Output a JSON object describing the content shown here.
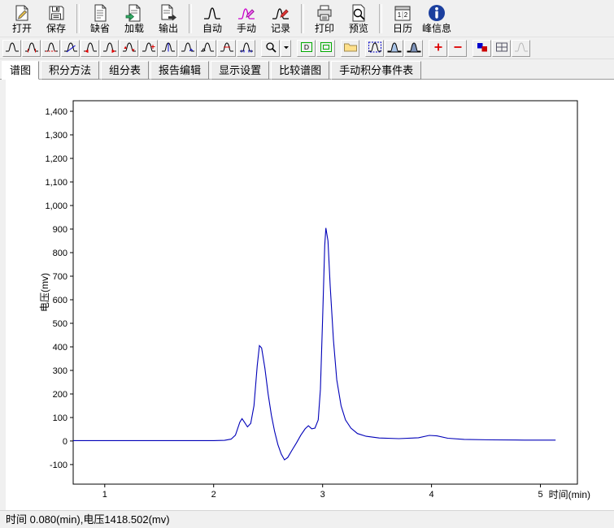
{
  "colors": {
    "line": "#0000b8",
    "toolbar_bg": "#f0f0f0",
    "panel_bg": "#ffffff"
  },
  "main_toolbar": {
    "groups": [
      {
        "items": [
          {
            "name": "open",
            "label": "打开",
            "icon": "open-icon"
          },
          {
            "name": "save",
            "label": "保存",
            "icon": "save-icon"
          }
        ]
      },
      {
        "items": [
          {
            "name": "default",
            "label": "缺省",
            "icon": "doc-default-icon"
          },
          {
            "name": "load",
            "label": "加载",
            "icon": "doc-load-icon"
          },
          {
            "name": "export",
            "label": "输出",
            "icon": "doc-export-icon"
          }
        ]
      },
      {
        "items": [
          {
            "name": "auto-integrate",
            "label": "自动",
            "icon": "auto-peak-icon"
          },
          {
            "name": "manual-integrate",
            "label": "手动",
            "icon": "manual-peak-icon"
          },
          {
            "name": "record",
            "label": "记录",
            "icon": "record-peak-icon"
          }
        ]
      },
      {
        "items": [
          {
            "name": "print",
            "label": "打印",
            "icon": "print-icon"
          },
          {
            "name": "print-preview",
            "label": "预览",
            "icon": "preview-icon"
          }
        ]
      },
      {
        "items": [
          {
            "name": "calendar",
            "label": "日历",
            "icon": "calendar-icon"
          },
          {
            "name": "peak-info",
            "label": "峰信息",
            "icon": "info-icon"
          }
        ]
      }
    ]
  },
  "secondary_toolbar": {
    "groups": [
      {
        "items": [
          {
            "name": "peak-baseline",
            "icon": "peak-plain-icon"
          },
          {
            "name": "peak-start-end",
            "icon": "peak-marks-icon"
          },
          {
            "name": "peak-baseline-dash",
            "icon": "peak-dash-icon"
          },
          {
            "name": "peak-tangent-skim",
            "icon": "peak-tangent-icon"
          },
          {
            "name": "peak-move-start-left",
            "icon": "peak-left-icon"
          },
          {
            "name": "peak-move-end-right",
            "icon": "peak-right-icon"
          },
          {
            "name": "peak-up-down-markers",
            "icon": "peak-updown-icon"
          },
          {
            "name": "peak-add",
            "icon": "peak-plus-icon"
          },
          {
            "name": "peak-drop-line",
            "icon": "peak-drop-icon"
          },
          {
            "name": "peak-valley",
            "icon": "peak-valley-icon"
          },
          {
            "name": "peak-shoulder",
            "icon": "peak-shoulder-icon"
          },
          {
            "name": "peak-half-width",
            "icon": "peak-half-icon"
          },
          {
            "name": "peak-baseline-ticks",
            "icon": "peak-ticks-icon"
          }
        ]
      },
      {
        "items": [
          {
            "name": "zoom",
            "icon": "zoom-icon"
          },
          {
            "name": "zoom-dropdown",
            "icon": "dropdown-arrow-icon",
            "narrow": true
          }
        ]
      },
      {
        "items": [
          {
            "name": "view-default",
            "icon": "view-d-icon"
          },
          {
            "name": "view-full",
            "icon": "view-full-icon"
          }
        ]
      },
      {
        "items": [
          {
            "name": "open-overlay-file",
            "icon": "folder-icon"
          }
        ]
      },
      {
        "items": [
          {
            "name": "overlay-box",
            "icon": "overlay-box-icon"
          },
          {
            "name": "overlay-fill",
            "icon": "overlay-fill-icon"
          },
          {
            "name": "overlay-shade",
            "icon": "overlay-shade-icon"
          }
        ]
      },
      {
        "items": [
          {
            "name": "overlay-add",
            "icon": "plus-red-icon"
          },
          {
            "name": "overlay-remove",
            "icon": "minus-red-icon"
          }
        ]
      },
      {
        "items": [
          {
            "name": "overlay-colors",
            "icon": "color-squares-icon"
          },
          {
            "name": "tile-view",
            "icon": "grid-view-icon"
          },
          {
            "name": "compare-disabled",
            "icon": "peak-gray-icon",
            "disabled": true
          }
        ]
      }
    ]
  },
  "tabs": {
    "items": [
      {
        "name": "chromatogram",
        "label": "谱图",
        "active": true
      },
      {
        "name": "integration-method",
        "label": "积分方法",
        "active": false
      },
      {
        "name": "component-table",
        "label": "组分表",
        "active": false
      },
      {
        "name": "report-edit",
        "label": "报告编辑",
        "active": false
      },
      {
        "name": "display-settings",
        "label": "显示设置",
        "active": false
      },
      {
        "name": "compare-chromatogram",
        "label": "比较谱图",
        "active": false
      },
      {
        "name": "manual-integration-events",
        "label": "手动积分事件表",
        "active": false
      }
    ]
  },
  "status": {
    "text": "时间 0.080(min),电压1418.502(mv)"
  },
  "chart_data": {
    "type": "line",
    "title": "",
    "xlabel": "时间(min)",
    "ylabel": "电压(mv)",
    "xlim": [
      0.71,
      5.34
    ],
    "ylim": [
      -183,
      1445
    ],
    "grid": false,
    "legend": false,
    "line_color": "#0000b8",
    "x_ticks": [
      {
        "v": 1,
        "label": "1"
      },
      {
        "v": 2,
        "label": "2"
      },
      {
        "v": 3,
        "label": "3"
      },
      {
        "v": 4,
        "label": "4"
      },
      {
        "v": 5,
        "label": "5"
      }
    ],
    "y_ticks": [
      {
        "v": -100,
        "label": "-100"
      },
      {
        "v": 0,
        "label": "0"
      },
      {
        "v": 100,
        "label": "100"
      },
      {
        "v": 200,
        "label": "200"
      },
      {
        "v": 300,
        "label": "300"
      },
      {
        "v": 400,
        "label": "400"
      },
      {
        "v": 500,
        "label": "500"
      },
      {
        "v": 600,
        "label": "600"
      },
      {
        "v": 700,
        "label": "700"
      },
      {
        "v": 800,
        "label": "800"
      },
      {
        "v": 900,
        "label": "900"
      },
      {
        "v": 1000,
        "label": "1,000"
      },
      {
        "v": 1100,
        "label": "1,100"
      },
      {
        "v": 1200,
        "label": "1,200"
      },
      {
        "v": 1300,
        "label": "1,300"
      },
      {
        "v": 1400,
        "label": "1,400"
      }
    ],
    "series": [
      {
        "name": "signal",
        "points": [
          [
            0.71,
            2
          ],
          [
            1.0,
            2
          ],
          [
            1.4,
            2
          ],
          [
            1.8,
            2
          ],
          [
            2.0,
            2
          ],
          [
            2.1,
            3
          ],
          [
            2.16,
            8
          ],
          [
            2.2,
            25
          ],
          [
            2.24,
            80
          ],
          [
            2.26,
            95
          ],
          [
            2.28,
            82
          ],
          [
            2.31,
            60
          ],
          [
            2.34,
            75
          ],
          [
            2.37,
            150
          ],
          [
            2.4,
            320
          ],
          [
            2.42,
            405
          ],
          [
            2.44,
            395
          ],
          [
            2.47,
            310
          ],
          [
            2.5,
            200
          ],
          [
            2.53,
            110
          ],
          [
            2.56,
            40
          ],
          [
            2.59,
            -15
          ],
          [
            2.62,
            -55
          ],
          [
            2.65,
            -80
          ],
          [
            2.68,
            -70
          ],
          [
            2.72,
            -38
          ],
          [
            2.76,
            -8
          ],
          [
            2.8,
            25
          ],
          [
            2.84,
            52
          ],
          [
            2.87,
            65
          ],
          [
            2.9,
            52
          ],
          [
            2.93,
            55
          ],
          [
            2.96,
            90
          ],
          [
            2.98,
            220
          ],
          [
            3.0,
            520
          ],
          [
            3.02,
            830
          ],
          [
            3.03,
            905
          ],
          [
            3.05,
            850
          ],
          [
            3.07,
            660
          ],
          [
            3.1,
            430
          ],
          [
            3.13,
            260
          ],
          [
            3.17,
            150
          ],
          [
            3.21,
            90
          ],
          [
            3.26,
            55
          ],
          [
            3.32,
            32
          ],
          [
            3.4,
            20
          ],
          [
            3.52,
            13
          ],
          [
            3.7,
            10
          ],
          [
            3.88,
            14
          ],
          [
            3.98,
            24
          ],
          [
            4.05,
            22
          ],
          [
            4.15,
            12
          ],
          [
            4.3,
            7
          ],
          [
            4.55,
            5
          ],
          [
            4.85,
            4
          ],
          [
            5.14,
            4
          ]
        ]
      }
    ]
  }
}
